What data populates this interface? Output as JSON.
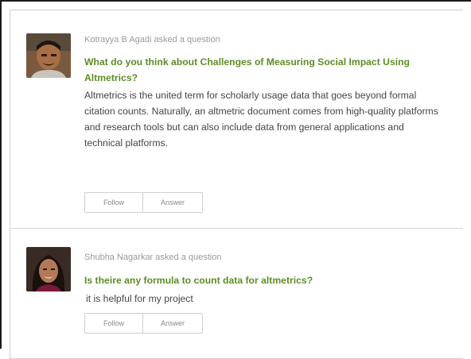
{
  "feed": {
    "items": [
      {
        "asker_line": "Kotrayya B Agadi asked a question",
        "question_title": "What do you think about Challenges of Measuring Social Impact Using Altmetrics?",
        "question_body": "Altmetrics is the united term for scholarly usage data that goes beyond formal citation counts. Naturally, an altmetric document comes from high-quality platforms and research tools but can also include data from general applications and technical platforms.",
        "follow_label": "Follow",
        "answer_label": "Answer"
      },
      {
        "asker_line": "Shubha Nagarkar asked a question",
        "question_title": "Is theire any formula to count data for altmetrics?",
        "question_body": "it is helpful for my project",
        "follow_label": "Follow",
        "answer_label": "Answer"
      }
    ]
  },
  "colors": {
    "question_title": "#5e8d25",
    "asker_text": "#9a9a9a",
    "body_text": "#444444",
    "border": "#cfcfcf"
  },
  "icons": {
    "avatar_1": "user-photo-man",
    "avatar_2": "user-photo-woman"
  }
}
